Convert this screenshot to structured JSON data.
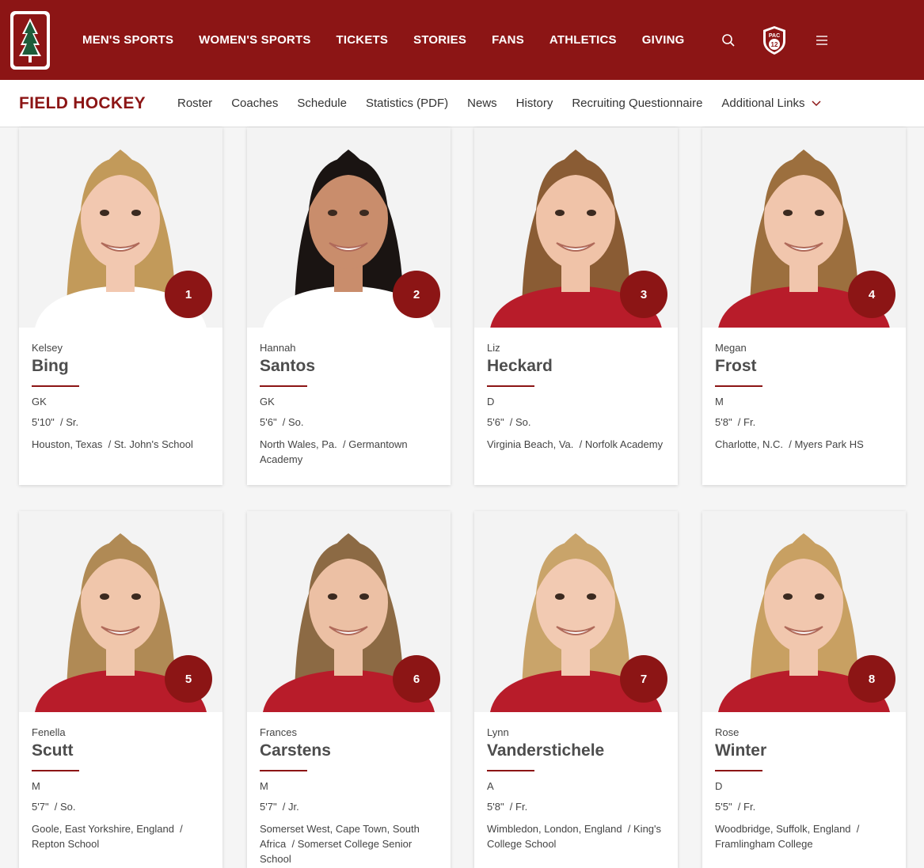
{
  "header": {
    "nav": [
      "MEN'S SPORTS",
      "WOMEN'S SPORTS",
      "TICKETS",
      "STORIES",
      "FANS",
      "ATHLETICS",
      "GIVING"
    ],
    "icons": [
      "search-icon",
      "pac12-logo-icon",
      "menu-icon"
    ],
    "pac_label": "PAC",
    "pac_num": "12"
  },
  "sport": {
    "title": "FIELD HOCKEY",
    "links": [
      "Roster",
      "Coaches",
      "Schedule",
      "Statistics (PDF)",
      "News",
      "History",
      "Recruiting Questionnaire"
    ],
    "more_label": "Additional Links"
  },
  "colors": {
    "cardinal": "#8c1515",
    "text": "#333333"
  },
  "players": [
    {
      "number": "1",
      "first": "Kelsey",
      "last": "Bing",
      "position": "GK",
      "height": "5'10\"",
      "year": "Sr.",
      "hometown": "Houston, Texas",
      "school": "St. John's School",
      "hair": "#c29a5a",
      "skin": "#f2c8b0",
      "shirt": "#ffffff"
    },
    {
      "number": "2",
      "first": "Hannah",
      "last": "Santos",
      "position": "GK",
      "height": "5'6\"",
      "year": "So.",
      "hometown": "North Wales, Pa.",
      "school": "Germantown Academy",
      "hair": "#1a1412",
      "skin": "#c98d6c",
      "shirt": "#ffffff"
    },
    {
      "number": "3",
      "first": "Liz",
      "last": "Heckard",
      "position": "D",
      "height": "5'6\"",
      "year": "So.",
      "hometown": "Virginia Beach, Va.",
      "school": "Norfolk Academy",
      "hair": "#8a5c34",
      "skin": "#f0c3a8",
      "shirt": "#b81c2a"
    },
    {
      "number": "4",
      "first": "Megan",
      "last": "Frost",
      "position": "M",
      "height": "5'8\"",
      "year": "Fr.",
      "hometown": "Charlotte, N.C.",
      "school": "Myers Park HS",
      "hair": "#9c6f3e",
      "skin": "#f1c6ad",
      "shirt": "#b81c2a"
    },
    {
      "number": "5",
      "first": "Fenella",
      "last": "Scutt",
      "position": "M",
      "height": "5'7\"",
      "year": "So.",
      "hometown": "Goole, East Yorkshire, England",
      "school": "Repton School",
      "hair": "#b08a55",
      "skin": "#f0c6ab",
      "shirt": "#b81c2a"
    },
    {
      "number": "6",
      "first": "Frances",
      "last": "Carstens",
      "position": "M",
      "height": "5'7\"",
      "year": "Jr.",
      "hometown": "Somerset West, Cape Town, South Africa",
      "school": "Somerset College Senior School",
      "hair": "#8c6a44",
      "skin": "#ecc0a4",
      "shirt": "#b81c2a"
    },
    {
      "number": "7",
      "first": "Lynn",
      "last": "Vanderstichele",
      "position": "A",
      "height": "5'8\"",
      "year": "Fr.",
      "hometown": "Wimbledon, London, England",
      "school": "King's College School",
      "hair": "#c9a46a",
      "skin": "#f2cab2",
      "shirt": "#b81c2a"
    },
    {
      "number": "8",
      "first": "Rose",
      "last": "Winter",
      "position": "D",
      "height": "5'5\"",
      "year": "Fr.",
      "hometown": "Woodbridge, Suffolk, England",
      "school": "Framlingham College",
      "hair": "#c8a062",
      "skin": "#f1c7ae",
      "shirt": "#b81c2a"
    }
  ]
}
